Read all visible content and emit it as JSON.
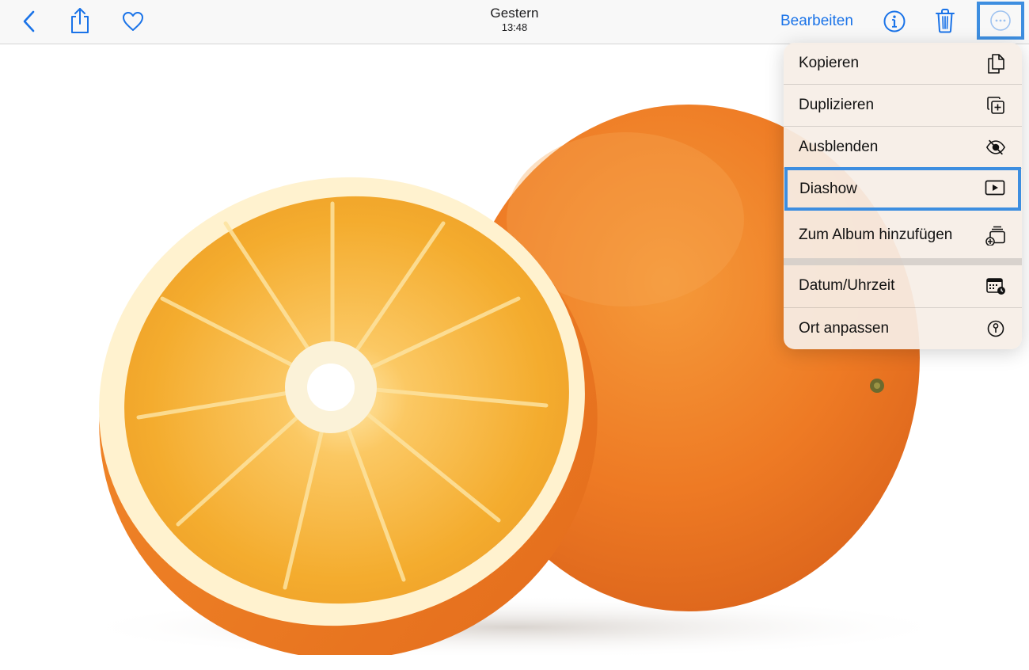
{
  "toolbar": {
    "title": "Gestern",
    "subtitle": "13:48",
    "edit_label": "Bearbeiten",
    "accent_color": "#1a73e8",
    "icons": {
      "back": "chevron-left-icon",
      "share": "share-icon",
      "favorite": "heart-icon",
      "info": "info-icon",
      "delete": "trash-icon",
      "more": "ellipsis-circle-icon"
    }
  },
  "photo": {
    "subject_colors": {
      "peel": "#ef7d1f",
      "pulp": "#f7b43a",
      "pith": "#fff3d6"
    }
  },
  "menu": {
    "items": [
      {
        "label": "Kopieren",
        "icon": "copy-icon"
      },
      {
        "label": "Duplizieren",
        "icon": "duplicate-icon"
      },
      {
        "label": "Ausblenden",
        "icon": "eye-slash-icon"
      },
      {
        "label": "Diashow",
        "icon": "play-rectangle-icon",
        "highlighted": true
      },
      {
        "label": "Zum Album hinzufügen",
        "icon": "add-to-album-icon"
      },
      {
        "label": "Datum/Uhrzeit",
        "icon": "calendar-clock-icon"
      },
      {
        "label": "Ort anpassen",
        "icon": "location-info-icon"
      }
    ],
    "highlight_color": "#3d8ee0"
  }
}
